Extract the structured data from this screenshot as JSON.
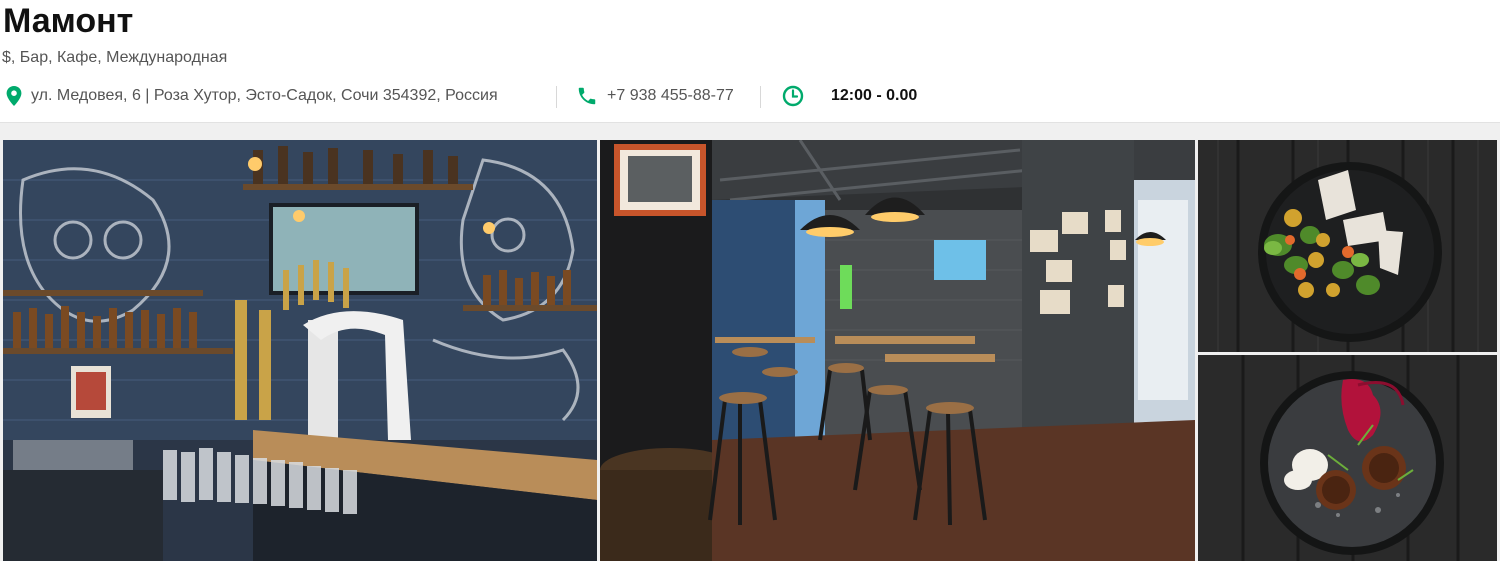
{
  "restaurant": {
    "name": "Мамонт",
    "categories": "$, Бар, Кафе, Международная",
    "address": "ул. Медовея, 6 | Роза Хутор, Эсто-Садок, Сочи 354392, Россия",
    "phone": "+7 938 455-88-77",
    "hours": "12:00 - 0.00"
  },
  "icons": {
    "address": "map-pin-icon",
    "phone": "phone-icon",
    "hours": "clock-icon"
  },
  "colors": {
    "accent": "#00aa6c",
    "title": "#111111",
    "text": "#555555"
  },
  "gallery": {
    "photos": [
      "bar-counter-photo",
      "interior-photo",
      "salad-dish-photo",
      "dessert-dish-photo"
    ]
  }
}
